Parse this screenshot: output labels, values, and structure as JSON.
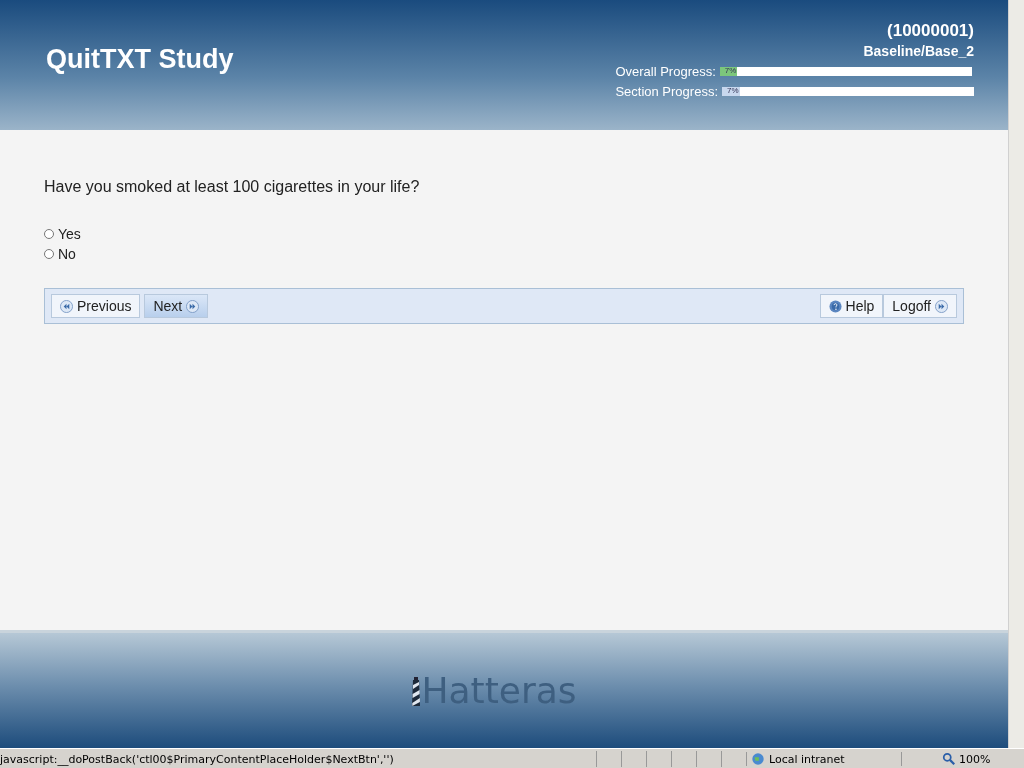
{
  "header": {
    "title": "QuitTXT Study",
    "participant_id": "(10000001)",
    "section": "Baseline/Base_2",
    "progress": [
      {
        "label": "Overall Progress:",
        "reading": "7%",
        "level": 0.07,
        "color": "#7cc77c"
      },
      {
        "label": "Section Progress:",
        "reading": "7%",
        "level": 0.07,
        "color": "#c8d8ee"
      }
    ]
  },
  "question": {
    "text": "Have you smoked at least 100 cigarettes in your life?",
    "options": [
      {
        "label": "Yes",
        "selected": false
      },
      {
        "label": "No",
        "selected": false
      }
    ]
  },
  "nav_buttons": [
    {
      "label": "Previous",
      "kind": "back",
      "highlighted": false
    },
    {
      "label": "Next",
      "kind": "forward",
      "highlighted": true
    }
  ],
  "right_buttons": [
    {
      "label": "Help",
      "kind": "help",
      "highlighted": false
    },
    {
      "label": "Logoff",
      "kind": "forward",
      "highlighted": false
    }
  ],
  "footer": {
    "logo": "Hatteras"
  },
  "status_bar": {
    "message": "javascript:__doPostBack('ctl00$PrimaryContentPlaceHolder$NextBtn','')",
    "zone": "Local intranet",
    "zoom": "100%"
  }
}
